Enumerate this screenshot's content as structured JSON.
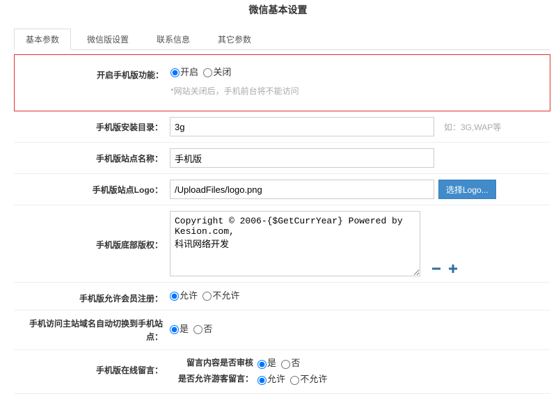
{
  "page_title": "微信基本设置",
  "tabs": [
    {
      "label": "基本参数",
      "active": true
    },
    {
      "label": "微信版设置",
      "active": false
    },
    {
      "label": "联系信息",
      "active": false
    },
    {
      "label": "其它参数",
      "active": false
    }
  ],
  "mobile_feature": {
    "label": "开启手机版功能：",
    "opt_on": "开启",
    "opt_off": "关闭",
    "hint": "*网站关闭后，手机前台将不能访问"
  },
  "install_dir": {
    "label": "手机版安装目录：",
    "value": "3g",
    "hint": "如：3G,WAP等"
  },
  "site_name": {
    "label": "手机版站点名称：",
    "value": "手机版"
  },
  "site_logo": {
    "label": "手机版站点Logo：",
    "value": "/UploadFiles/logo.png",
    "button": "选择Logo..."
  },
  "footer_copy": {
    "label": "手机版底部版权：",
    "value": "Copyright © 2006-{$GetCurrYear} Powered by Kesion.com,\n科讯网络开发"
  },
  "allow_reg": {
    "label": "手机版允许会员注册：",
    "opt_yes": "允许",
    "opt_no": "不允许"
  },
  "auto_switch": {
    "label": "手机访问主站域名自动切换到手机站点：",
    "opt_yes": "是",
    "opt_no": "否"
  },
  "guestbook": {
    "label": "手机版在线留言：",
    "sub1_label": "留言内容是否审核",
    "sub1_yes": "是",
    "sub1_no": "否",
    "sub2_label": "是否允许游客留言：",
    "sub2_yes": "允许",
    "sub2_no": "不允许"
  }
}
